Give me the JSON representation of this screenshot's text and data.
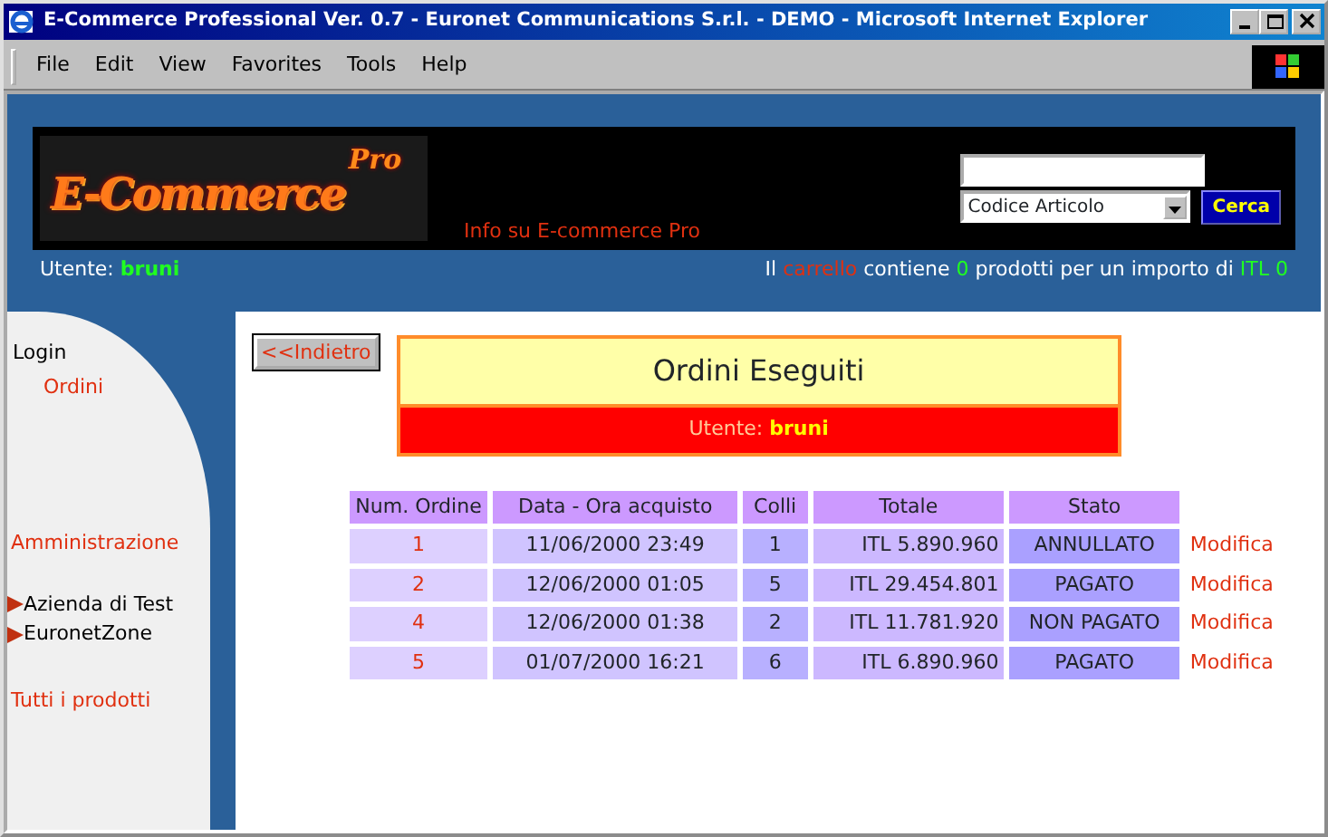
{
  "window": {
    "title": "E-Commerce Professional Ver. 0.7 - Euronet Communications S.r.l. - DEMO - Microsoft Internet Explorer"
  },
  "menu": [
    "File",
    "Edit",
    "View",
    "Favorites",
    "Tools",
    "Help"
  ],
  "header": {
    "logo": {
      "main": "E-Commerce",
      "sup": "Pro"
    },
    "info_link": "Info su E-commerce Pro",
    "search": {
      "select": "Codice Articolo",
      "button": "Cerca"
    },
    "user": {
      "label": "Utente:",
      "name": "bruni"
    },
    "cart": {
      "prefix": "Il",
      "link": "carrello",
      "middle": "contiene",
      "count": "0",
      "suffix": "prodotti per un importo di",
      "total": "ITL 0"
    }
  },
  "sidebar": {
    "items": [
      {
        "label": "Login",
        "kind": "plain"
      },
      {
        "label": "Ordini",
        "kind": "sublink"
      },
      {
        "label": "Amministrazione",
        "kind": "section"
      },
      {
        "label": "Azienda di Test",
        "kind": "arrow"
      },
      {
        "label": "EuronetZone",
        "kind": "arrow"
      },
      {
        "label": "Tutti i prodotti",
        "kind": "section"
      }
    ]
  },
  "back_button": "<<Indietro",
  "panel": {
    "title": "Ordini Eseguiti",
    "user_label": "Utente:",
    "user_name": "bruni"
  },
  "table": {
    "columns": [
      "Num. Ordine",
      "Data - Ora acquisto",
      "Colli",
      "Totale",
      "Stato"
    ],
    "rows": [
      {
        "number": "1",
        "datetime": "11/06/2000 23:49",
        "parcels": "1",
        "total": "ITL 5.890.960",
        "status": "ANNULLATO",
        "action": "Modifica"
      },
      {
        "number": "2",
        "datetime": "12/06/2000 01:05",
        "parcels": "5",
        "total": "ITL 29.454.801",
        "status": "PAGATO",
        "action": "Modifica"
      },
      {
        "number": "4",
        "datetime": "12/06/2000 01:38",
        "parcels": "2",
        "total": "ITL 11.781.920",
        "status": "NON PAGATO",
        "action": "Modifica"
      },
      {
        "number": "5",
        "datetime": "01/07/2000 16:21",
        "parcels": "6",
        "total": "ITL 6.890.960",
        "status": "PAGATO",
        "action": "Modifica"
      }
    ]
  }
}
